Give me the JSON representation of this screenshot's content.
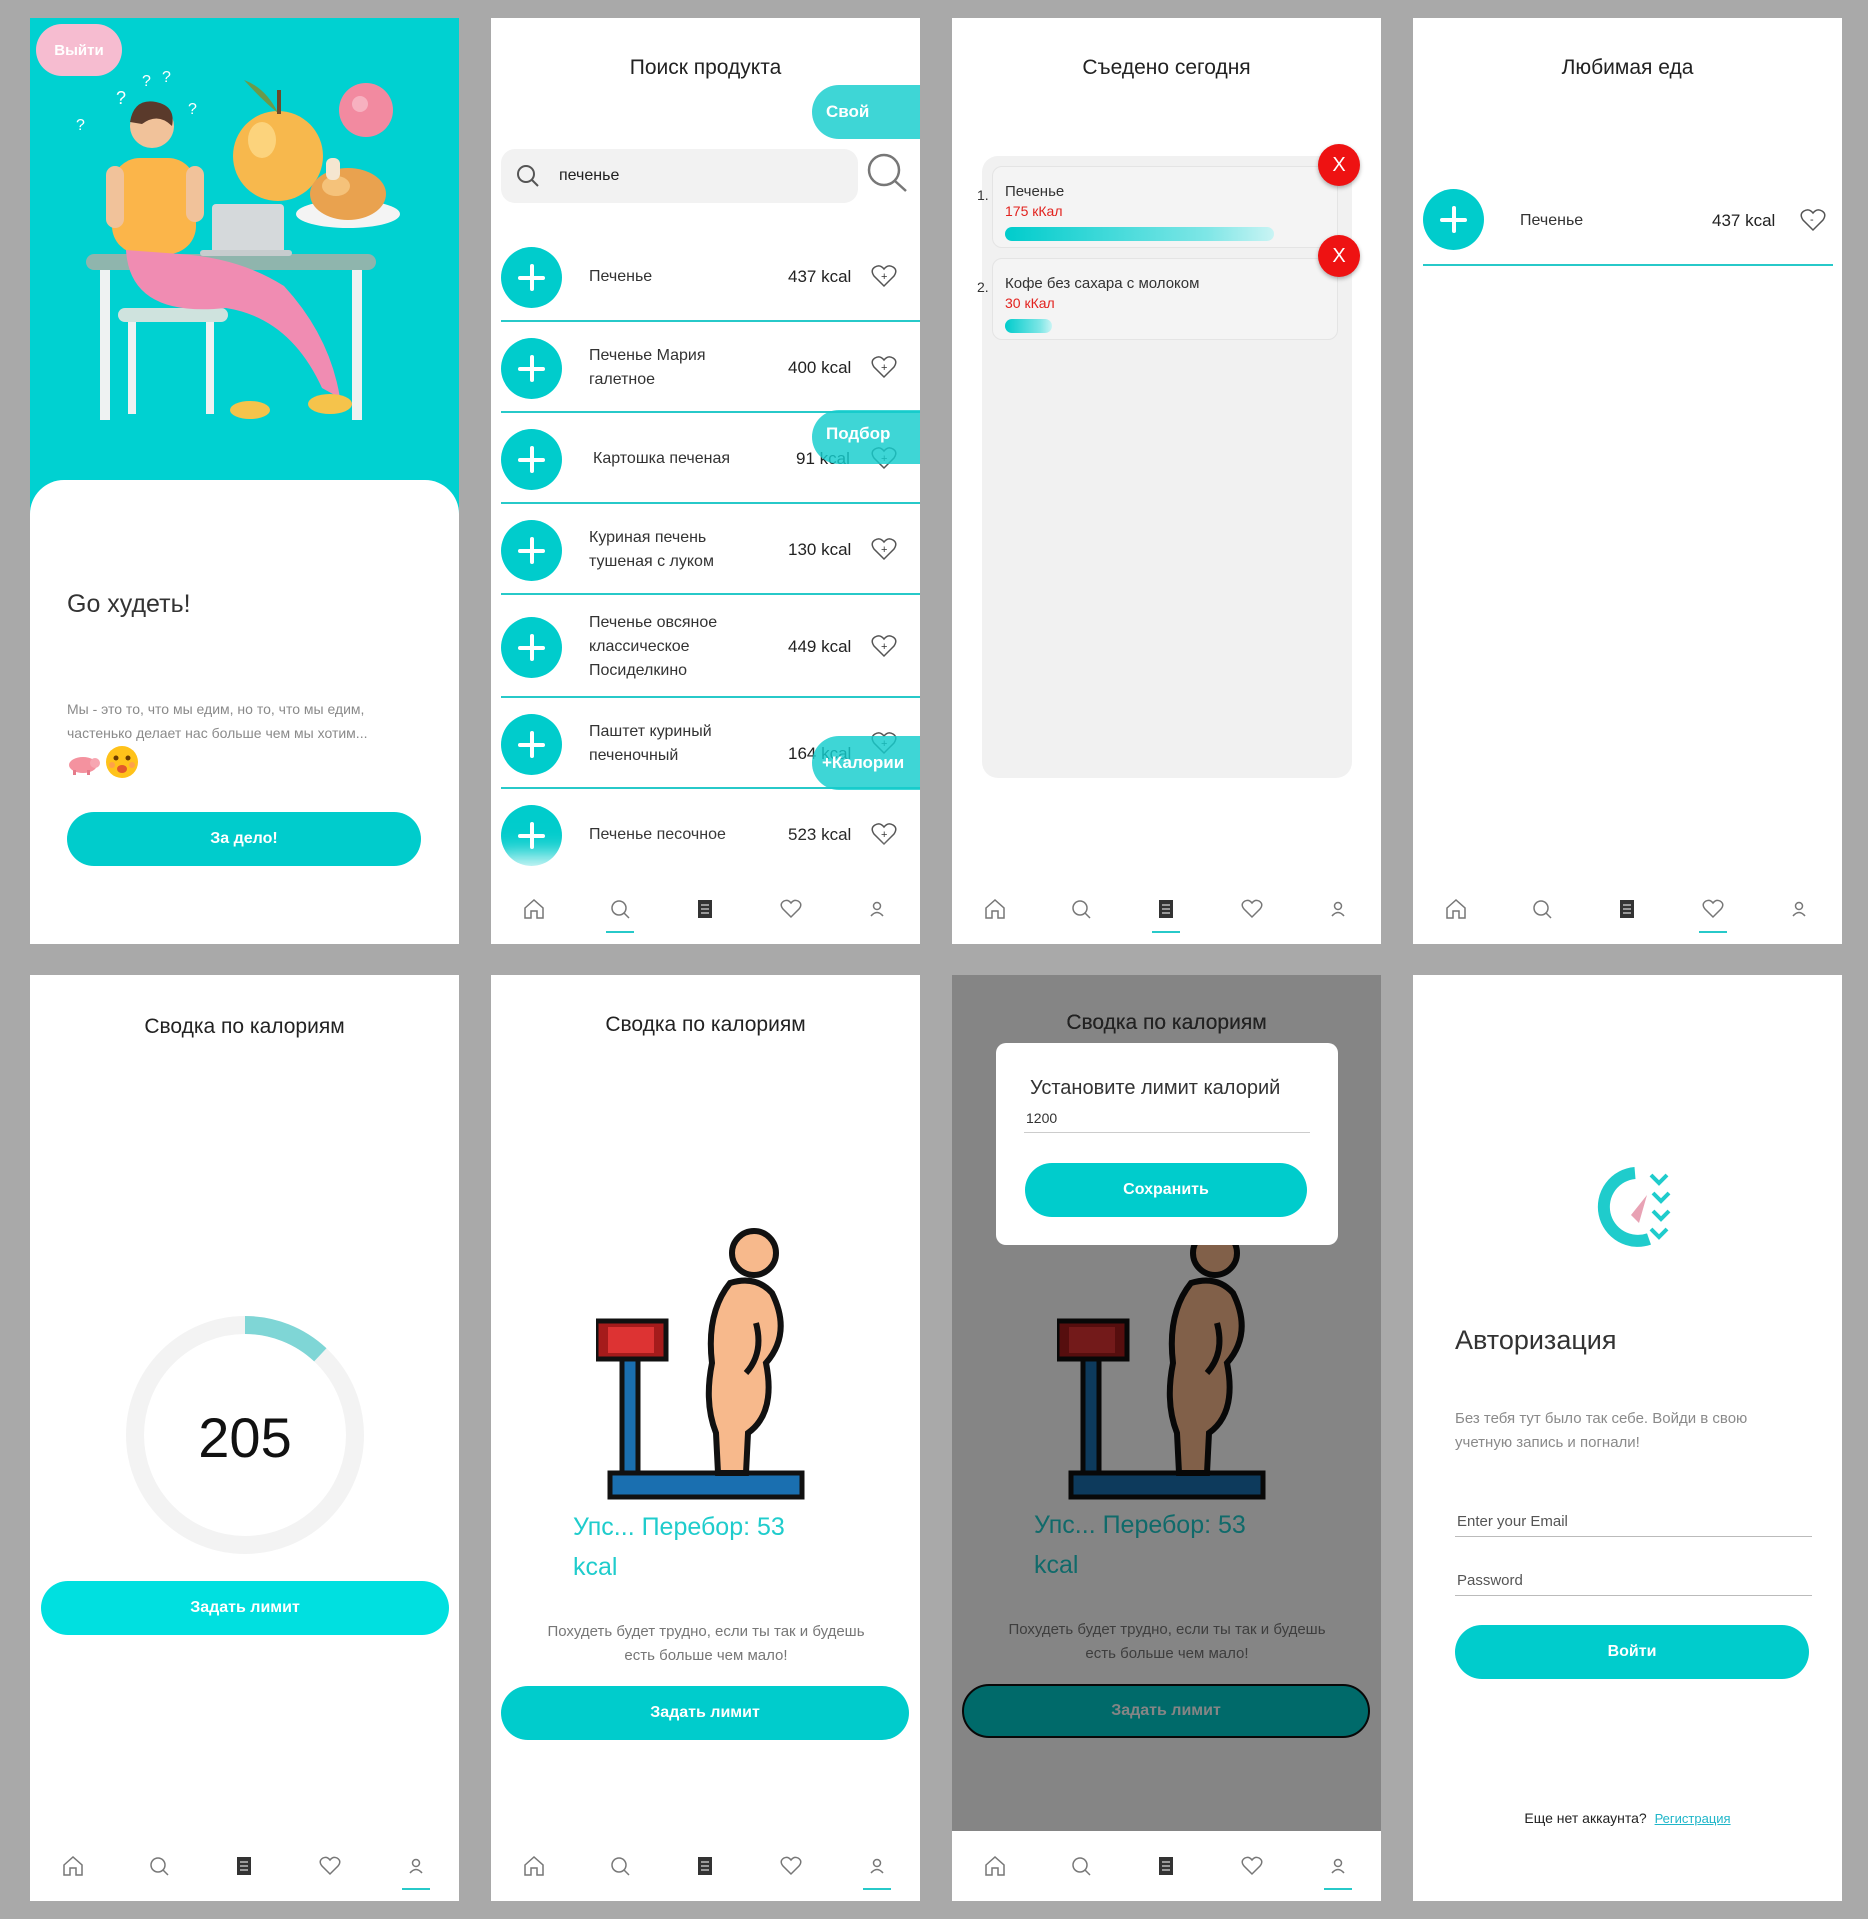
{
  "colors": {
    "accent": "#00CCCC",
    "bg": "#A9A9A9",
    "danger": "#EE1212",
    "pink": "#F6BCD0"
  },
  "icons": {
    "nav": [
      "home-icon",
      "search-icon",
      "journal-icon",
      "heart-icon",
      "user-icon"
    ]
  },
  "welcome": {
    "logout": "Выйти",
    "title": "Go худеть!",
    "text": "Мы - это то, что мы едим, но то, что мы едим, частенько делает нас больше чем мы хотим...",
    "button": "За дело!"
  },
  "search": {
    "title": "Поиск продукта",
    "query": "печенье",
    "tab_own": "Свой",
    "tab_pick": "Подбор",
    "tab_calories": "+Калории",
    "items": [
      {
        "name": "Печенье",
        "kcal": "437 kcal"
      },
      {
        "name": "Печенье Мария галетное",
        "kcal": "400 kcal"
      },
      {
        "name": "Картошка печеная",
        "kcal": "91 kcal"
      },
      {
        "name": "Куриная печень тушеная с луком",
        "kcal": "130 kcal"
      },
      {
        "name": "Печенье овсяное классическое Посиделкино",
        "kcal": "449 kcal"
      },
      {
        "name": "Паштет куриный печеночный",
        "kcal": "164 kcal"
      },
      {
        "name": "Печенье песочное",
        "kcal": "523 kcal"
      }
    ]
  },
  "eaten": {
    "title": "Съедено сегодня",
    "items": [
      {
        "num": "1.",
        "name": "Печенье",
        "kcal": "175 кКал",
        "share": 0.85
      },
      {
        "num": "2.",
        "name": "Кофе без сахара с молоком",
        "kcal": "30 кКал",
        "share": 0.15
      }
    ],
    "remove": "X"
  },
  "favorites": {
    "title": "Любимая еда",
    "items": [
      {
        "name": "Печенье",
        "kcal": "437 kcal"
      }
    ]
  },
  "summary": {
    "title": "Сводка по калориям",
    "value": "205",
    "progress": 0.12,
    "button": "Задать лимит",
    "over_title": "Упс... Перебор: 53 kcal",
    "over_text": "Похудеть будет трудно, если ты так и будешь есть больше чем мало!"
  },
  "limit_modal": {
    "title": "Установите лимит калорий",
    "value": "1200",
    "save": "Сохранить"
  },
  "auth": {
    "title": "Авторизация",
    "subtitle": "Без тебя тут было так себе. Войди в свою учетную запись и погнали!",
    "email_placeholder": "Enter your Email",
    "password_placeholder": "Password",
    "login": "Войти",
    "no_account": "Еще нет аккаунта?",
    "register": "Регистрация"
  }
}
